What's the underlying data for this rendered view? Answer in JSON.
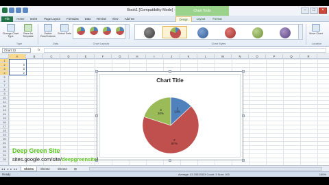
{
  "window": {
    "title": "Book1  [Compatibility Mode]  -  Microsoft Excel",
    "chart_tools_label": "Chart Tools"
  },
  "tabs": [
    "File",
    "Home",
    "Insert",
    "Page Layout",
    "Formulas",
    "Data",
    "Review",
    "View",
    "Add-Ins",
    "Design",
    "Layout",
    "Format"
  ],
  "ribbon": {
    "type_buttons": [
      "Change Chart Type",
      "Save As Template"
    ],
    "data_buttons": [
      "Switch Row/Column",
      "Select Data"
    ],
    "move_chart": "Move Chart",
    "groups": [
      "Type",
      "Data",
      "Chart Layouts",
      "Chart Styles",
      "Location"
    ]
  },
  "formula_bar": {
    "name_box": "Chart 12",
    "fx": "fx",
    "formula": ""
  },
  "columns": [
    "A",
    "B",
    "C",
    "D",
    "E",
    "F",
    "G",
    "H",
    "I",
    "J",
    "K",
    "L",
    "M",
    "N",
    "O",
    "P",
    "Q",
    "R"
  ],
  "rows": [
    "1",
    "2",
    "3",
    "4",
    "5",
    "6",
    "7",
    "8",
    "9",
    "10",
    "11",
    "12",
    "13",
    "14",
    "15",
    "16",
    "17",
    "18",
    "19",
    "20",
    "21",
    "22",
    "23",
    "24",
    "25"
  ],
  "cells": [
    "5",
    "8",
    "2"
  ],
  "chart": {
    "title": "Chart Title",
    "style_colors": [
      "#4f81bd",
      "#4f81bd",
      "#c0504d",
      "#9bbb59",
      "#8064a2",
      "#4bacc6"
    ]
  },
  "chart_data": {
    "type": "pie",
    "title": "Chart Title",
    "categories": [
      "1",
      "2",
      "3"
    ],
    "values": [
      13,
      67,
      20
    ],
    "labels": [
      "1\n13%",
      "2\n67%",
      "3\n20%"
    ],
    "colors": [
      "#4f81bd",
      "#c0504d",
      "#9bbb59"
    ]
  },
  "watermark": {
    "name": "Deep Green Site",
    "url_prefix": "sites.google.com/site/",
    "url_highlight": "deepgreensite",
    "url_suffix": "/"
  },
  "sheets": [
    "Sheet1",
    "Sheet2",
    "Sheet3"
  ],
  "status": {
    "ready": "Ready",
    "stats": "Average: 33.33333333    Count: 3    Sum: 100",
    "zoom": "100%"
  }
}
